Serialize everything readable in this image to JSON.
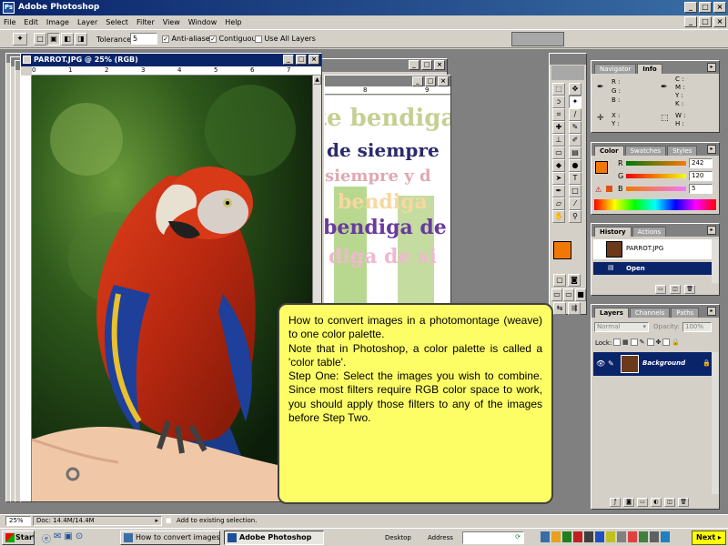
{
  "app": {
    "title": "Adobe Photoshop"
  },
  "menu": [
    "File",
    "Edit",
    "Image",
    "Layer",
    "Select",
    "Filter",
    "View",
    "Window",
    "Help"
  ],
  "options": {
    "tolerance_label": "Tolerance:",
    "tolerance_value": "5",
    "anti_aliased": "Anti-aliased",
    "contiguous": "Contiguous",
    "use_all_layers": "Use All Layers"
  },
  "document": {
    "title": "PARROT.JPG @ 25% (RGB)",
    "ruler_ticks": [
      "0",
      "1",
      "2",
      "3",
      "4",
      "5",
      "6",
      "7"
    ],
    "second_ruler_ticks": [
      "8",
      "9"
    ]
  },
  "background_text": [
    "te bendiga",
    "de siempre",
    "siempre y d",
    "bendiga",
    "bendiga de",
    "diga de si"
  ],
  "palettes": {
    "navigator_tabs": [
      "Navigator",
      "Info"
    ],
    "info": {
      "r": "R :",
      "g": "G :",
      "b": "B :",
      "c": "C :",
      "m": "M :",
      "y": "Y :",
      "k": "K :",
      "x": "X :",
      "yy": "Y :",
      "w": "W :",
      "h": "H :"
    },
    "color_tabs": [
      "Color",
      "Swatches",
      "Styles"
    ],
    "color": {
      "r_label": "R",
      "g_label": "G",
      "b_label": "B",
      "r": "242",
      "g": "120",
      "b": "5"
    },
    "history_tabs": [
      "History",
      "Actions"
    ],
    "history": {
      "snapshot": "PARROT.JPG",
      "step": "Open"
    },
    "layers_tabs": [
      "Layers",
      "Channels",
      "Paths"
    ],
    "layers": {
      "blend": "Normal",
      "opacity_label": "Opacity:",
      "opacity": "100%",
      "lock_label": "Lock:",
      "layer_name": "Background"
    }
  },
  "callout": {
    "p1": "How to convert images in a photomontage (weave) to one color palette.",
    "p2": "Note that in Photoshop, a color palette is called a 'color table'.",
    "p3": "Step One: Select the images you wish to combine. Since most filters require RGB color space to work, you should apply those filters to any of the images before Step Two."
  },
  "status": {
    "zoom": "25%",
    "doc": "Doc: 14.4M/14.4M",
    "hint": "Add to existing selection."
  },
  "taskbar": {
    "start": "Start",
    "task1": "How to convert images i...",
    "task2": "Adobe Photoshop",
    "desktop": "Desktop",
    "address": "Address",
    "time": "",
    "next": "Next"
  },
  "colors": {
    "foreground": "#f27805",
    "background": "#1a3c8c",
    "accent": "#0a246a"
  }
}
